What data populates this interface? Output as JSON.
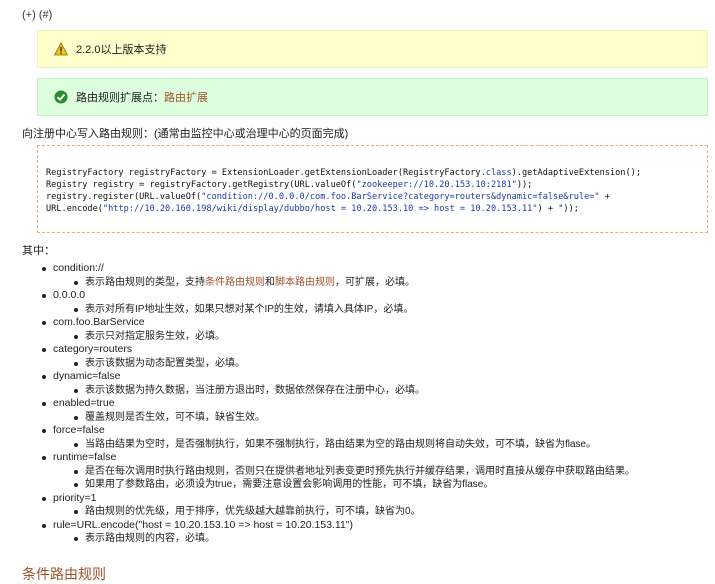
{
  "top_links": {
    "plus": "(+)",
    "hash": "(#)"
  },
  "warning": {
    "icon": "warning-icon",
    "text": "2.2.0以上版本支持"
  },
  "tip": {
    "icon": "check-icon",
    "prefix": "路由规则扩展点：",
    "link": "路由扩展"
  },
  "intro": "向注册中心写入路由规则：(通常由监控中心或治理中心的页面完成)",
  "code": {
    "l1a": "RegistryFactory registryFactory = ExtensionLoader.getExtensionLoader(RegistryFactory.",
    "l1kw": "class",
    "l1b": ").getAdaptiveExtension();",
    "l2a": "Registry registry = registryFactory.getRegistry(URL.valueOf(",
    "l2s": "\"zookeeper://10.20.153.10:2181\"",
    "l2b": "));",
    "l3a": "registry.register(URL.valueOf(",
    "l3s": "\"condition://0.0.0.0/com.foo.BarService?category=routers&dynamic=false&rule=\"",
    "l3b": " +",
    "l4a": "URL.encode(",
    "l4s": "\"http://10.20.160.198/wiki/display/dubbo/host = 10.20.153.10 => host = 10.20.153.11\"",
    "l4b": ") + \"));"
  },
  "section_label": "其中：",
  "params": [
    {
      "name": "condition://",
      "desc": [
        "表示路由规则的类型，支持",
        "条件路由规则",
        "和",
        "脚本路由规则",
        "，可扩展，必填。"
      ]
    },
    {
      "name": "0.0.0.0",
      "desc": "表示对所有IP地址生效，如果只想对某个IP的生效，请填入具体IP，必填。"
    },
    {
      "name": "com.foo.BarService",
      "desc": "表示只对指定服务生效，必填。"
    },
    {
      "name": "category=routers",
      "desc": "表示该数据为动态配置类型，必填。"
    },
    {
      "name": "dynamic=false",
      "desc": "表示该数据为持久数据，当注册方退出时，数据依然保存在注册中心，必填。"
    },
    {
      "name": "enabled=true",
      "desc": "覆盖规则是否生效，可不填，缺省生效。"
    },
    {
      "name": "force=false",
      "desc": "当路由结果为空时，是否强制执行，如果不强制执行，路由结果为空的路由规则将自动失效，可不填，缺省为flase。"
    },
    {
      "name": "runtime=false",
      "desc": "是否在每次调用时执行路由规则，否则只在提供者地址列表变更时预先执行并缓存结果，调用时直接从缓存中获取路由结果。",
      "desc2": "如果用了参数路由，必须设为true，需要注意设置会影响调用的性能，可不填，缺省为flase。"
    },
    {
      "name": "priority=1",
      "desc": "路由规则的优先级，用于排序，优先级越大越靠前执行，可不填，缺省为0。"
    },
    {
      "name": "rule=URL.encode(\"host = 10.20.153.10 => host = 10.20.153.11\")",
      "desc": "表示路由规则的内容，必填。"
    }
  ],
  "bottom_heading": "条件路由规则"
}
